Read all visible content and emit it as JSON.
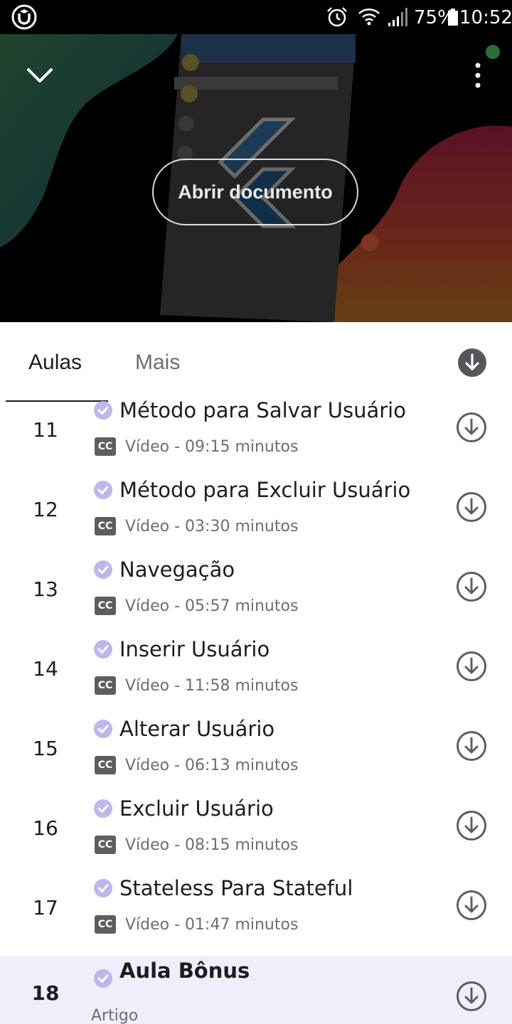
{
  "status_bar": {
    "battery_percent": "75%",
    "time": "10:52"
  },
  "player": {
    "open_document_label": "Abrir documento",
    "colors": {
      "accent_orange": "#e5603a",
      "accent_magenta": "#b8285a",
      "accent_green": "#3f7a4a"
    }
  },
  "tabs": {
    "lessons_label": "Aulas",
    "more_label": "Mais"
  },
  "lessons": [
    {
      "number": "11",
      "title": "Método para Salvar Usuário",
      "cc": "CC",
      "meta": "Vídeo - 09:15 minutos"
    },
    {
      "number": "12",
      "title": "Método para Excluir Usuário",
      "cc": "CC",
      "meta": "Vídeo - 03:30 minutos"
    },
    {
      "number": "13",
      "title": "Navegação",
      "cc": "CC",
      "meta": "Vídeo - 05:57 minutos"
    },
    {
      "number": "14",
      "title": "Inserir Usuário",
      "cc": "CC",
      "meta": "Vídeo - 11:58 minutos"
    },
    {
      "number": "15",
      "title": "Alterar Usuário",
      "cc": "CC",
      "meta": "Vídeo - 06:13 minutos"
    },
    {
      "number": "16",
      "title": "Excluir Usuário",
      "cc": "CC",
      "meta": "Vídeo - 08:15 minutos"
    },
    {
      "number": "17",
      "title": "Stateless Para Stateful",
      "cc": "CC",
      "meta": "Vídeo - 01:47 minutos"
    },
    {
      "number": "18",
      "title": "Aula Bônus",
      "meta": "Artigo",
      "current": true
    }
  ],
  "icons": {
    "app_logo": "udemy-logo-icon",
    "alarm": "alarm-icon",
    "wifi": "wifi-icon",
    "signal": "signal-icon",
    "battery": "battery-icon",
    "collapse": "chevron-down-icon",
    "more": "more-vertical-icon",
    "download": "download-circle-icon",
    "completed": "check-circle-icon"
  }
}
